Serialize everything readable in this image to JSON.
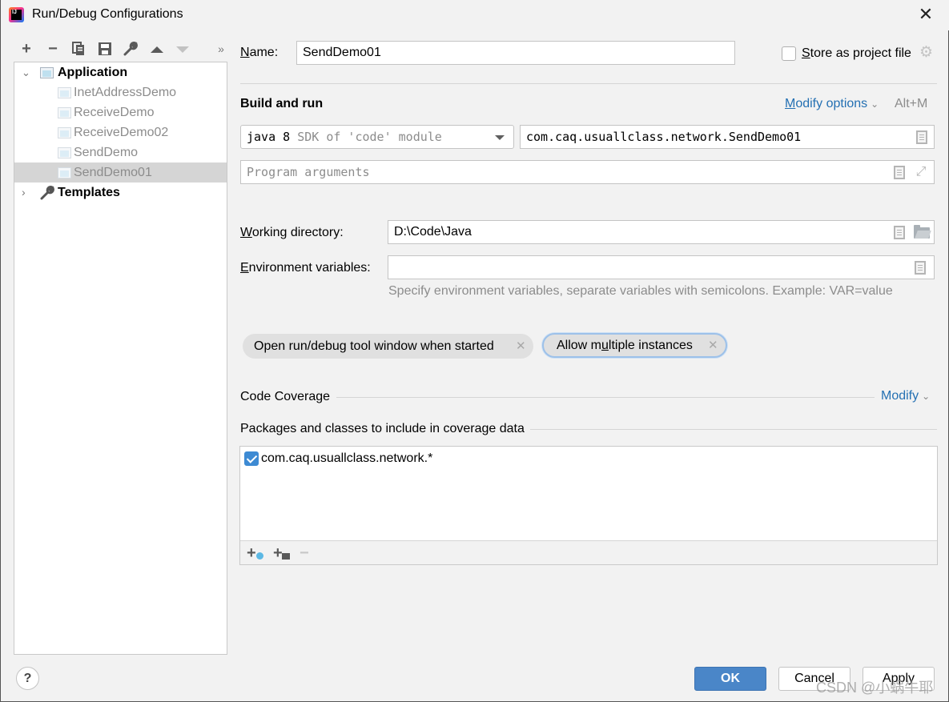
{
  "window": {
    "title": "Run/Debug Configurations",
    "logo_text": "IJ"
  },
  "toolbar": {
    "icons": [
      {
        "name": "add-icon",
        "glyph": "+",
        "enabled": true
      },
      {
        "name": "remove-icon",
        "glyph": "−",
        "enabled": true
      },
      {
        "name": "copy-icon",
        "glyph": "⧉",
        "enabled": true
      },
      {
        "name": "save-icon",
        "glyph": "💾",
        "enabled": true
      },
      {
        "name": "wrench-icon",
        "glyph": "🔧",
        "enabled": true
      },
      {
        "name": "move-up-icon",
        "glyph": "▲",
        "enabled": true
      },
      {
        "name": "move-down-icon",
        "glyph": "▼",
        "enabled": false
      },
      {
        "name": "more-icon",
        "glyph": "»",
        "enabled": true
      }
    ]
  },
  "tree": {
    "application": {
      "label": "Application",
      "expanded": true
    },
    "children": [
      {
        "label": "InetAddressDemo"
      },
      {
        "label": "ReceiveDemo"
      },
      {
        "label": "ReceiveDemo02"
      },
      {
        "label": "SendDemo"
      },
      {
        "label": "SendDemo01",
        "selected": true
      }
    ],
    "templates": {
      "label": "Templates",
      "expanded": false
    }
  },
  "form": {
    "name_label": "Name:",
    "name_mnemonic": "N",
    "name_rest": "ame:",
    "name_value": "SendDemo01",
    "store_label_mnemonic": "S",
    "store_label_rest": "tore as project file",
    "store_checked": false,
    "build_and_run": "Build and run",
    "modify_options_mnemonic": "M",
    "modify_options_rest": "odify options",
    "modify_options_shortcut": "Alt+M",
    "jdk_primary": "java 8",
    "jdk_secondary": "SDK of 'code' module",
    "main_class": "com.caq.usuallclass.network.SendDemo01",
    "program_args_placeholder": "Program arguments",
    "working_dir_mnemonic": "W",
    "working_dir_rest": "orking directory:",
    "working_dir_value": "D:\\Code\\Java",
    "env_vars_mnemonic": "E",
    "env_vars_rest": "nvironment variables:",
    "env_vars_value": "",
    "env_vars_hint": "Specify environment variables, separate variables with semicolons. Example: VAR=value"
  },
  "chips": [
    {
      "label": "Open run/debug tool window when started",
      "focused": false
    },
    {
      "label_pre": "Allow m",
      "label_mnemonic": "u",
      "label_post": "ltiple instances",
      "focused": true
    }
  ],
  "coverage": {
    "section_title": "Code Coverage",
    "modify_label": "Modify",
    "packages_title": "Packages and classes to include in coverage data",
    "items": [
      {
        "label": "com.caq.usuallclass.network.*",
        "checked": true
      }
    ],
    "toolbar": [
      {
        "name": "add-class-icon",
        "enabled": true
      },
      {
        "name": "add-package-icon",
        "enabled": true
      },
      {
        "name": "remove-icon",
        "enabled": false
      }
    ]
  },
  "buttons": {
    "help": "?",
    "ok": "OK",
    "cancel": "Cancel",
    "apply": "Apply"
  },
  "watermark": "CSDN @小蜗牛耶",
  "colors": {
    "accent": "#4a86c8",
    "link": "#2470b3",
    "selection": "#d5d5d5",
    "checkbox": "#3d8ad3"
  }
}
